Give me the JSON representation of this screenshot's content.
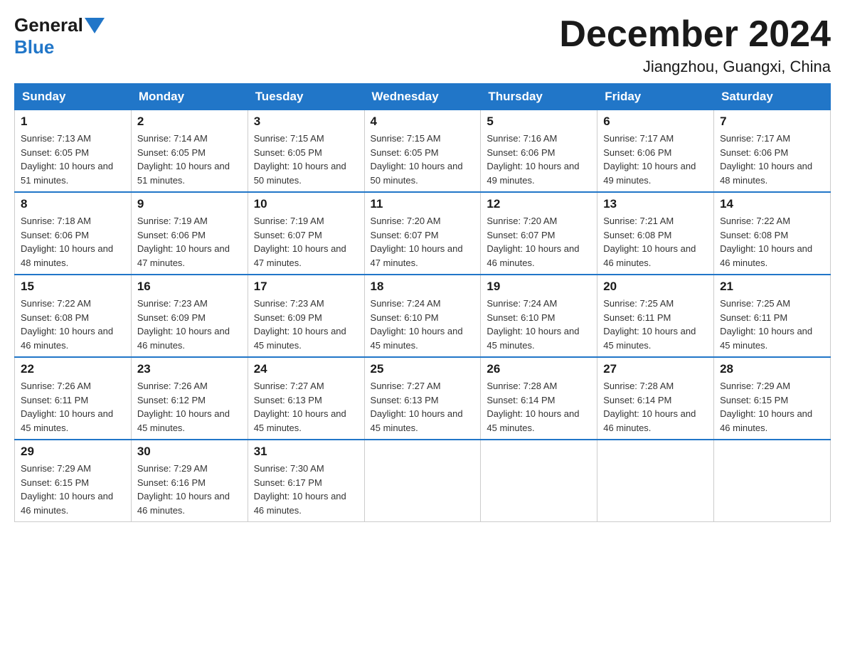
{
  "header": {
    "logo_general": "General",
    "logo_blue": "Blue",
    "month_title": "December 2024",
    "location": "Jiangzhou, Guangxi, China"
  },
  "calendar": {
    "days_of_week": [
      "Sunday",
      "Monday",
      "Tuesday",
      "Wednesday",
      "Thursday",
      "Friday",
      "Saturday"
    ],
    "weeks": [
      [
        {
          "day": "1",
          "sunrise": "7:13 AM",
          "sunset": "6:05 PM",
          "daylight": "10 hours and 51 minutes."
        },
        {
          "day": "2",
          "sunrise": "7:14 AM",
          "sunset": "6:05 PM",
          "daylight": "10 hours and 51 minutes."
        },
        {
          "day": "3",
          "sunrise": "7:15 AM",
          "sunset": "6:05 PM",
          "daylight": "10 hours and 50 minutes."
        },
        {
          "day": "4",
          "sunrise": "7:15 AM",
          "sunset": "6:05 PM",
          "daylight": "10 hours and 50 minutes."
        },
        {
          "day": "5",
          "sunrise": "7:16 AM",
          "sunset": "6:06 PM",
          "daylight": "10 hours and 49 minutes."
        },
        {
          "day": "6",
          "sunrise": "7:17 AM",
          "sunset": "6:06 PM",
          "daylight": "10 hours and 49 minutes."
        },
        {
          "day": "7",
          "sunrise": "7:17 AM",
          "sunset": "6:06 PM",
          "daylight": "10 hours and 48 minutes."
        }
      ],
      [
        {
          "day": "8",
          "sunrise": "7:18 AM",
          "sunset": "6:06 PM",
          "daylight": "10 hours and 48 minutes."
        },
        {
          "day": "9",
          "sunrise": "7:19 AM",
          "sunset": "6:06 PM",
          "daylight": "10 hours and 47 minutes."
        },
        {
          "day": "10",
          "sunrise": "7:19 AM",
          "sunset": "6:07 PM",
          "daylight": "10 hours and 47 minutes."
        },
        {
          "day": "11",
          "sunrise": "7:20 AM",
          "sunset": "6:07 PM",
          "daylight": "10 hours and 47 minutes."
        },
        {
          "day": "12",
          "sunrise": "7:20 AM",
          "sunset": "6:07 PM",
          "daylight": "10 hours and 46 minutes."
        },
        {
          "day": "13",
          "sunrise": "7:21 AM",
          "sunset": "6:08 PM",
          "daylight": "10 hours and 46 minutes."
        },
        {
          "day": "14",
          "sunrise": "7:22 AM",
          "sunset": "6:08 PM",
          "daylight": "10 hours and 46 minutes."
        }
      ],
      [
        {
          "day": "15",
          "sunrise": "7:22 AM",
          "sunset": "6:08 PM",
          "daylight": "10 hours and 46 minutes."
        },
        {
          "day": "16",
          "sunrise": "7:23 AM",
          "sunset": "6:09 PM",
          "daylight": "10 hours and 46 minutes."
        },
        {
          "day": "17",
          "sunrise": "7:23 AM",
          "sunset": "6:09 PM",
          "daylight": "10 hours and 45 minutes."
        },
        {
          "day": "18",
          "sunrise": "7:24 AM",
          "sunset": "6:10 PM",
          "daylight": "10 hours and 45 minutes."
        },
        {
          "day": "19",
          "sunrise": "7:24 AM",
          "sunset": "6:10 PM",
          "daylight": "10 hours and 45 minutes."
        },
        {
          "day": "20",
          "sunrise": "7:25 AM",
          "sunset": "6:11 PM",
          "daylight": "10 hours and 45 minutes."
        },
        {
          "day": "21",
          "sunrise": "7:25 AM",
          "sunset": "6:11 PM",
          "daylight": "10 hours and 45 minutes."
        }
      ],
      [
        {
          "day": "22",
          "sunrise": "7:26 AM",
          "sunset": "6:11 PM",
          "daylight": "10 hours and 45 minutes."
        },
        {
          "day": "23",
          "sunrise": "7:26 AM",
          "sunset": "6:12 PM",
          "daylight": "10 hours and 45 minutes."
        },
        {
          "day": "24",
          "sunrise": "7:27 AM",
          "sunset": "6:13 PM",
          "daylight": "10 hours and 45 minutes."
        },
        {
          "day": "25",
          "sunrise": "7:27 AM",
          "sunset": "6:13 PM",
          "daylight": "10 hours and 45 minutes."
        },
        {
          "day": "26",
          "sunrise": "7:28 AM",
          "sunset": "6:14 PM",
          "daylight": "10 hours and 45 minutes."
        },
        {
          "day": "27",
          "sunrise": "7:28 AM",
          "sunset": "6:14 PM",
          "daylight": "10 hours and 46 minutes."
        },
        {
          "day": "28",
          "sunrise": "7:29 AM",
          "sunset": "6:15 PM",
          "daylight": "10 hours and 46 minutes."
        }
      ],
      [
        {
          "day": "29",
          "sunrise": "7:29 AM",
          "sunset": "6:15 PM",
          "daylight": "10 hours and 46 minutes."
        },
        {
          "day": "30",
          "sunrise": "7:29 AM",
          "sunset": "6:16 PM",
          "daylight": "10 hours and 46 minutes."
        },
        {
          "day": "31",
          "sunrise": "7:30 AM",
          "sunset": "6:17 PM",
          "daylight": "10 hours and 46 minutes."
        },
        null,
        null,
        null,
        null
      ]
    ],
    "labels": {
      "sunrise": "Sunrise: ",
      "sunset": "Sunset: ",
      "daylight": "Daylight: "
    }
  }
}
